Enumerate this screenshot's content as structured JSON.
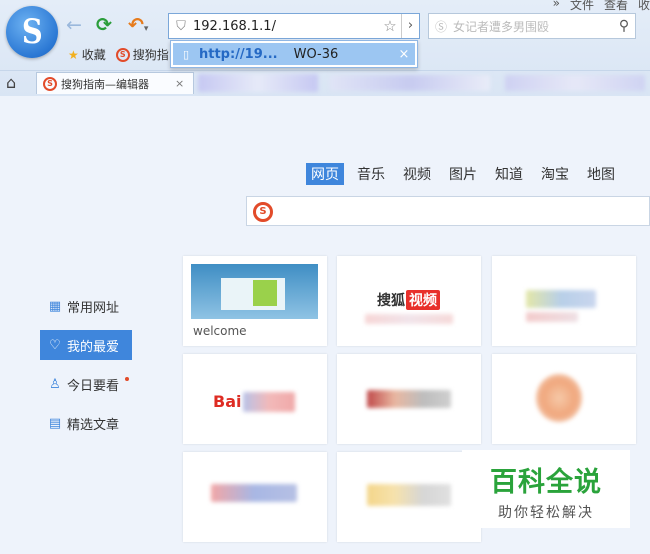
{
  "browser": {
    "menu": [
      "文件",
      "查看",
      "收"
    ],
    "address": "192.168.1.1/",
    "search_placeholder": "女记者遭多男围殴",
    "favorites": [
      "收藏",
      "搜狗指"
    ],
    "suggestion": {
      "url": "http://19...",
      "title": "WO-36"
    },
    "tab_title": "搜狗指南—编辑器",
    "overflow": "»"
  },
  "page": {
    "nav_tabs": [
      "网页",
      "音乐",
      "视频",
      "图片",
      "知道",
      "淘宝",
      "地图"
    ],
    "sidebar": [
      "常用网址",
      "我的最爱",
      "今日要看",
      "精选文章"
    ],
    "tiles": {
      "welcome_caption": "welcome",
      "sohu_text": "搜狐",
      "sohu_badge": "视频",
      "baidu_text": "Bai"
    }
  },
  "watermark": {
    "title": "百科全说",
    "subtitle": "助你轻松解决"
  },
  "icons": [
    "sogou-logo-icon",
    "back-icon",
    "refresh-icon",
    "undo-icon",
    "shield-icon",
    "star-icon",
    "forward-arrow-icon",
    "search-icon",
    "home-icon",
    "grid-icon",
    "heart-icon",
    "person-icon",
    "article-icon"
  ],
  "colors": {
    "accent": "#3f86dc",
    "sogou_red": "#e24b2a",
    "watermark_green": "#2aa33b"
  }
}
